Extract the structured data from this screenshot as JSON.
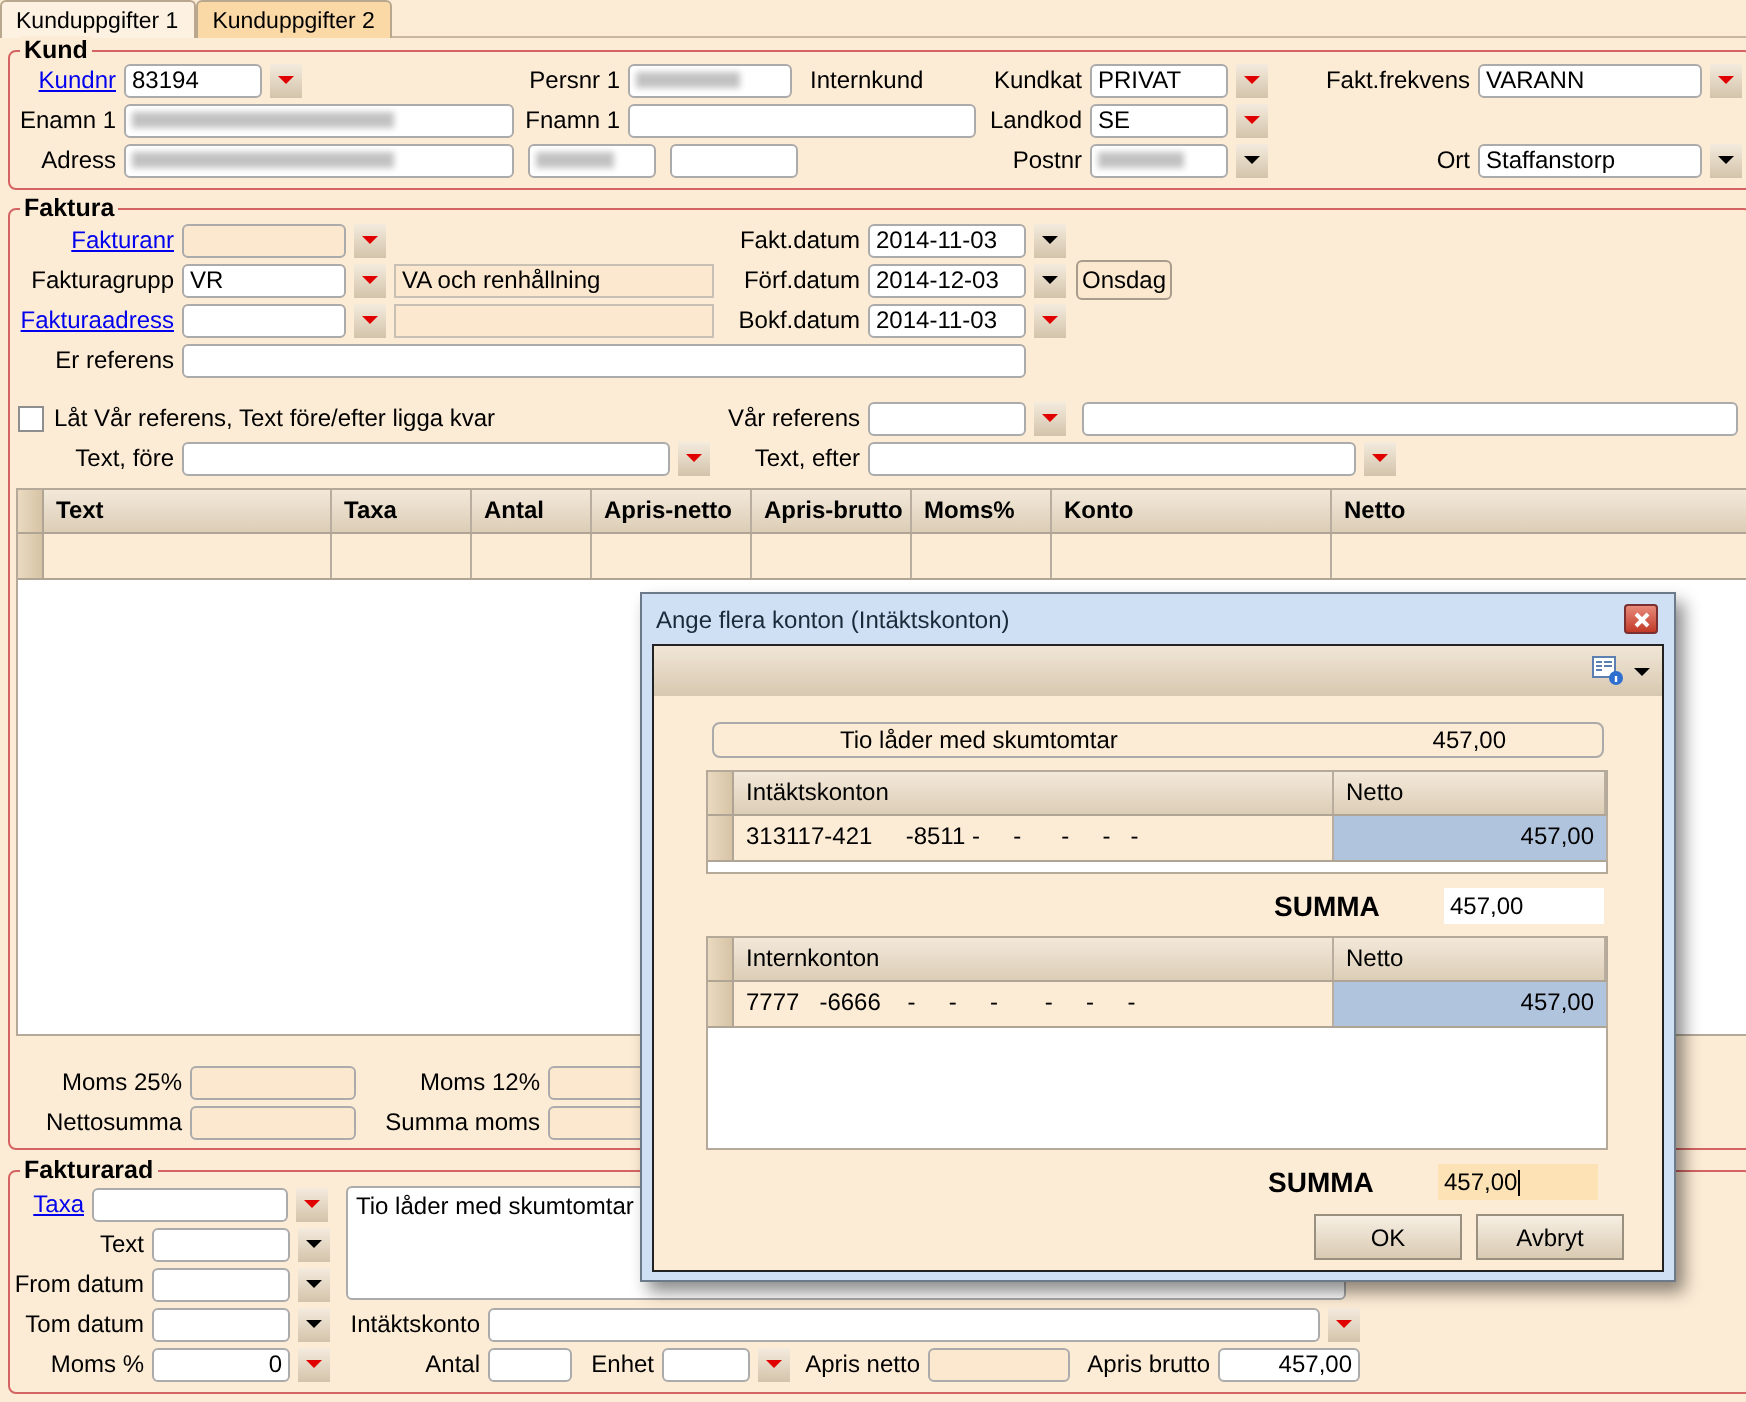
{
  "tabs": [
    {
      "label": "Kunduppgifter 1",
      "selected": true
    },
    {
      "label": "Kunduppgifter 2",
      "selected": false
    }
  ],
  "kund": {
    "title": "Kund",
    "lines": [
      {
        "fields": [
          {
            "kind": "field",
            "label": "Kundnr",
            "link": true,
            "value": "83194",
            "dropdown": true,
            "required": true
          },
          {
            "kind": "field",
            "label": "Persnr 1",
            "redacted": true
          },
          {
            "kind": "text",
            "text": "Internkund"
          },
          {
            "kind": "field",
            "label": "Kundkat",
            "value": "PRIVAT",
            "dropdown": true,
            "required": true
          },
          {
            "kind": "field",
            "label": "Fakt.frekvens",
            "value": "VARANN",
            "dropdown": true,
            "required": true
          }
        ]
      },
      {
        "fields": [
          {
            "kind": "field",
            "label": "Enamn 1",
            "redacted": true
          },
          {
            "kind": "field",
            "label": "Fnamn 1"
          },
          {
            "kind": "field",
            "label": "Landkod",
            "value": "SE",
            "dropdown": true,
            "required": true
          }
        ]
      },
      {
        "fields": [
          {
            "kind": "field",
            "label": "Adress",
            "redacted": true
          },
          {
            "kind": "field",
            "redacted": true
          },
          {
            "kind": "field"
          },
          {
            "kind": "field",
            "label": "Postnr",
            "redacted": true,
            "dropdown": true,
            "required": false
          },
          {
            "kind": "field",
            "label": "Ort",
            "value": "Staffanstorp",
            "dropdown": true,
            "required": false
          }
        ]
      }
    ]
  },
  "faktura": {
    "title": "Faktura",
    "lines": [
      {
        "fields": [
          {
            "kind": "field",
            "label": "Fakturanr",
            "link": true,
            "readonly": true,
            "dropdown": true,
            "required": true
          },
          {
            "kind": "field",
            "label": "Fakt.datum",
            "value": "2014-11-03",
            "dropdown": true,
            "required": false
          }
        ]
      },
      {
        "fields": [
          {
            "kind": "field",
            "label": "Fakturagrupp",
            "value": "VR",
            "dropdown": true,
            "required": true
          },
          {
            "kind": "field",
            "readonly": true,
            "value": "VA och renhållning"
          },
          {
            "kind": "field",
            "label": "Förf.datum",
            "value": "2014-12-03",
            "dropdown": true,
            "required": false
          },
          {
            "kind": "button",
            "label": "Onsdag"
          }
        ]
      },
      {
        "fields": [
          {
            "kind": "field",
            "label": "Fakturaadress",
            "link": true,
            "dropdown": true,
            "required": true
          },
          {
            "kind": "field",
            "readonly": true
          },
          {
            "kind": "field",
            "label": "Bokf.datum",
            "value": "2014-11-03",
            "dropdown": true,
            "required": true
          }
        ]
      },
      {
        "fields": [
          {
            "kind": "field",
            "label": "Er referens"
          }
        ]
      },
      {
        "fields": [
          {
            "kind": "checkbox",
            "label": "Låt Vår referens, Text före/efter ligga kvar",
            "checked": false
          },
          {
            "kind": "field",
            "label": "Vår referens",
            "dropdown": true,
            "required": true
          },
          {
            "kind": "field"
          }
        ]
      },
      {
        "fields": [
          {
            "kind": "field",
            "label": "Text, före",
            "dropdown": true,
            "required": true
          },
          {
            "kind": "field",
            "label": "Text, efter",
            "dropdown": true,
            "required": true
          }
        ]
      }
    ],
    "table": {
      "columns": [
        "Text",
        "Taxa",
        "Antal",
        "Apris-netto",
        "Apris-brutto",
        "Moms%",
        "Konto",
        "Netto"
      ]
    },
    "totals": [
      {
        "fields": [
          {
            "kind": "field",
            "label": "Moms 25%",
            "readonly": true
          },
          {
            "kind": "field",
            "label": "Moms 12%",
            "readonly": true
          }
        ]
      },
      {
        "fields": [
          {
            "kind": "field",
            "label": "Nettosumma",
            "readonly": true
          },
          {
            "kind": "field",
            "label": "Summa moms",
            "readonly": true
          }
        ]
      }
    ]
  },
  "fakturarad": {
    "title": "Fakturarad",
    "left_lines": [
      {
        "fields": [
          {
            "kind": "field",
            "label": "Taxa",
            "link": true,
            "dropdown": true,
            "required": true
          }
        ]
      },
      {
        "fields": [
          {
            "kind": "field",
            "label": "Text",
            "dropdown": true,
            "required": false
          }
        ]
      },
      {
        "fields": [
          {
            "kind": "field",
            "label": "From datum",
            "dropdown": true,
            "required": false
          }
        ]
      },
      {
        "fields": [
          {
            "kind": "field",
            "label": "Tom datum",
            "dropdown": true,
            "required": false
          }
        ]
      },
      {
        "fields": [
          {
            "kind": "field",
            "label": "Moms %",
            "value": "0",
            "dropdown": true,
            "required": true
          }
        ]
      }
    ],
    "description": "Tio låder med skumtomtar",
    "right_lines": [
      {
        "fields": [
          {
            "kind": "field",
            "label": "Intäktskonto",
            "dropdown": true,
            "required": true
          }
        ]
      },
      {
        "fields": [
          {
            "kind": "field",
            "label": "Antal"
          },
          {
            "kind": "field",
            "label": "Enhet",
            "dropdown": true,
            "required": true
          },
          {
            "kind": "field",
            "label": "Apris netto",
            "readonly": true
          },
          {
            "kind": "field",
            "label": "Apris brutto",
            "value": "457,00"
          }
        ]
      }
    ]
  },
  "dialog": {
    "title": "Ange flera konton (Intäktskonton)",
    "summary": {
      "text": "Tio låder med skumtomtar",
      "amount": "457,00"
    },
    "grids": [
      {
        "columns": [
          "Intäktskonton",
          "Netto"
        ],
        "rows": [
          {
            "account": "313117-421     -8511 -     -      -     -   -",
            "netto": "457,00",
            "selected": true
          }
        ],
        "sum_label": "SUMMA",
        "sum_value": "457,00",
        "focused": false
      },
      {
        "columns": [
          "Internkonton",
          "Netto"
        ],
        "rows": [
          {
            "account": "7777   -6666    -     -     -       -     -     -",
            "netto": "457,00",
            "selected": true
          }
        ],
        "sum_label": "SUMMA",
        "sum_value": "457,00",
        "focused": true
      }
    ],
    "buttons": [
      "OK",
      "Avbryt"
    ]
  }
}
